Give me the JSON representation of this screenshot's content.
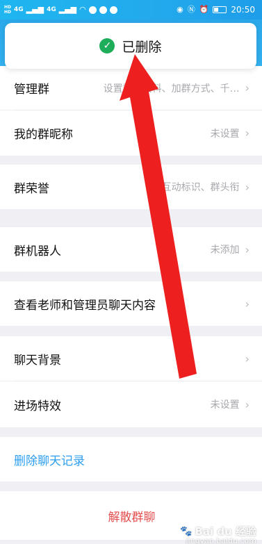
{
  "status_bar": {
    "left_tags": [
      "HD",
      "HD"
    ],
    "signal_1": "4G",
    "signal_2": "4G",
    "time": "20:50",
    "battery_level": 0.35
  },
  "toast": {
    "icon": "check-circle-icon",
    "text": "已删除"
  },
  "settings": {
    "rows": [
      {
        "label": "管理群",
        "value": "设置群聊资料、加群方式、千…"
      },
      {
        "label": "我的群昵称",
        "value": "未设置"
      },
      {
        "label": "群荣誉",
        "value": "群互动标识、群头衔"
      },
      {
        "label": "群机器人",
        "value": "未添加"
      },
      {
        "label": "查看老师和管理员聊天内容",
        "value": ""
      },
      {
        "label": "聊天背景",
        "value": ""
      },
      {
        "label": "进场特效",
        "value": "未设置"
      },
      {
        "label": "删除聊天记录",
        "value": ""
      },
      {
        "label": "解散群聊",
        "value": ""
      }
    ],
    "chevron": "›"
  },
  "watermark": {
    "brand": "Bai du 经验",
    "sub": "jingyan.baidu.com"
  },
  "colors": {
    "accent": "#2aa8ea",
    "link": "#2b9ef0",
    "danger": "#e64f4f",
    "arrow": "#ee1f1f",
    "success": "#1ead5a"
  }
}
